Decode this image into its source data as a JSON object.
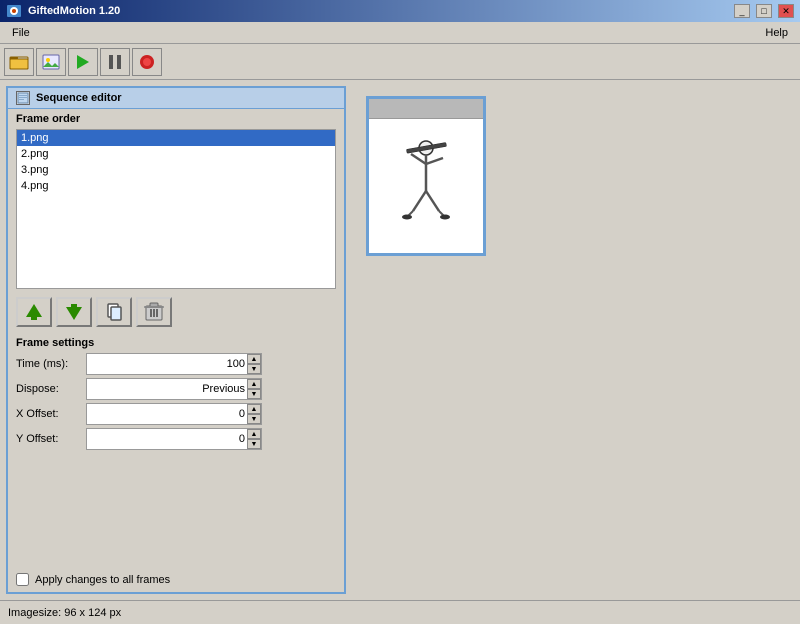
{
  "titleBar": {
    "title": "GiftedMotion 1.20",
    "minimizeLabel": "_",
    "maximizeLabel": "□",
    "closeLabel": "✕"
  },
  "menuBar": {
    "file": "File",
    "help": "Help"
  },
  "toolbar": {
    "openLabel": "📂",
    "insertLabel": "🖼",
    "playLabel": "▶",
    "pauseLabel": "⏸",
    "recordLabel": "⏺"
  },
  "sequenceEditor": {
    "title": "Sequence editor",
    "frameOrderLabel": "Frame order",
    "frames": [
      {
        "name": "1.png",
        "selected": true
      },
      {
        "name": "2.png",
        "selected": false
      },
      {
        "name": "3.png",
        "selected": false
      },
      {
        "name": "4.png",
        "selected": false
      }
    ]
  },
  "frameSettings": {
    "label": "Frame settings",
    "timeLabel": "Time (ms):",
    "timeValue": "100",
    "disposeLabel": "Dispose:",
    "disposeValue": "Previous",
    "xOffsetLabel": "X Offset:",
    "xOffsetValue": "0",
    "yOffsetLabel": "Y Offset:",
    "yOffsetValue": "0",
    "applyLabel": "Apply changes to all frames"
  },
  "statusBar": {
    "text": "Imagesize: 96 x 124 px"
  }
}
